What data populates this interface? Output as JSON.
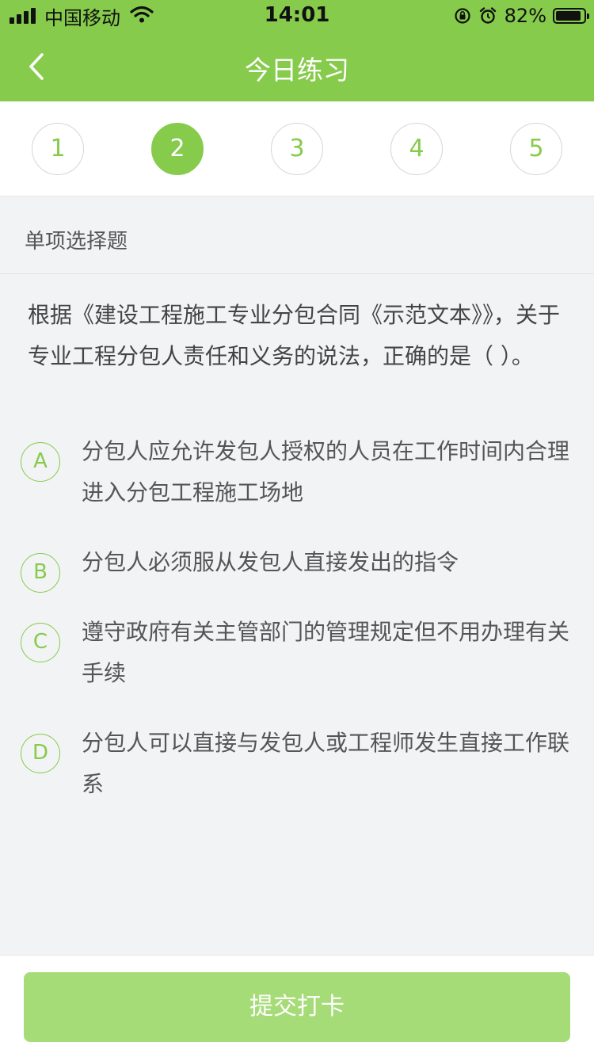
{
  "status_bar": {
    "carrier": "中国移动",
    "time": "14:01",
    "battery": "82%"
  },
  "nav": {
    "title": "今日练习"
  },
  "steps": [
    "1",
    "2",
    "3",
    "4",
    "5"
  ],
  "question": {
    "type": "单项选择题",
    "text": "根据《建设工程施工专业分包合同《示范文本》》，关于专业工程分包人责任和义务的说法，正确的是（ ）。",
    "options": [
      {
        "letter": "A",
        "text": "分包人应允许发包人授权的人员在工作时间内合理进入分包工程施工场地"
      },
      {
        "letter": "B",
        "text": "分包人必须服从发包人直接发出的指令"
      },
      {
        "letter": "C",
        "text": "遵守政府有关主管部门的管理规定但不用办理有关手续"
      },
      {
        "letter": "D",
        "text": "分包人可以直接与发包人或工程师发生直接工作联系"
      }
    ]
  },
  "submit": {
    "label": "提交打卡"
  },
  "colors": {
    "accent": "#86cb4b",
    "submit_bg": "#a6dc78",
    "page_bg": "#f2f3f5"
  }
}
